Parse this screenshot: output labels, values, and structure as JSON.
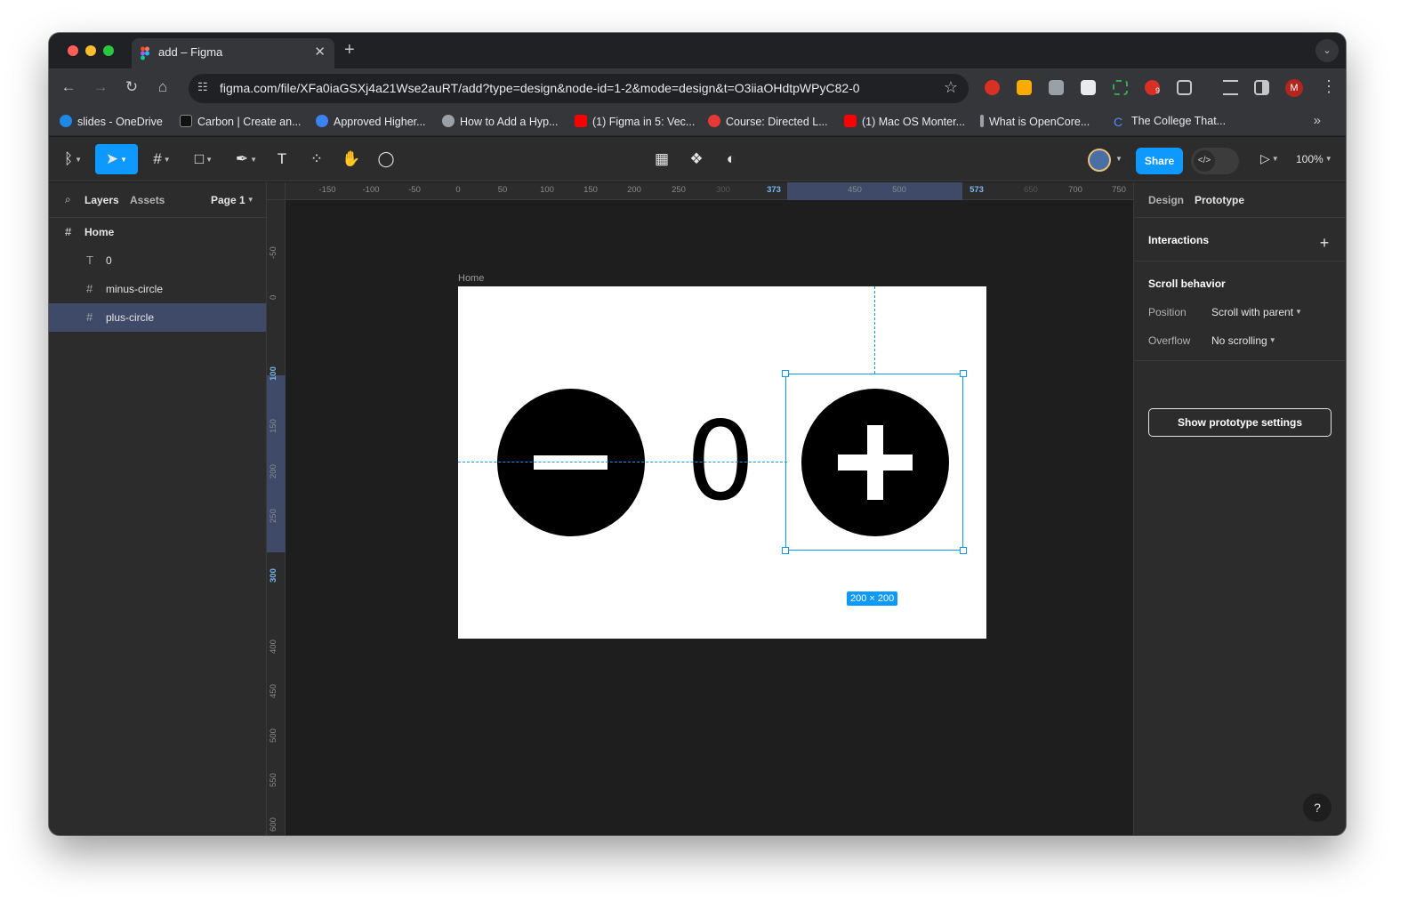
{
  "browser": {
    "tab_title": "add – Figma",
    "url": "figma.com/file/XFa0iaGSXj4a21Wse2auRT/add?type=design&node-id=1-2&mode=design&t=O3iiaOHdtpWPyC82-0",
    "profile_initial": "M",
    "extension_badge": "9",
    "bookmarks": [
      {
        "label": "slides - OneDrive",
        "color": "#1e88e5"
      },
      {
        "label": "Carbon | Create an...",
        "color": "#222222"
      },
      {
        "label": "Approved Higher...",
        "color": "#3b82f6"
      },
      {
        "label": "How to Add a Hyp...",
        "color": "#9aa0a6"
      },
      {
        "label": "(1) Figma in 5: Vec...",
        "color": "#ff0000"
      },
      {
        "label": "Course: Directed L...",
        "color": "#e53935"
      },
      {
        "label": "(1) Mac OS Monter...",
        "color": "#ff0000"
      },
      {
        "label": "What is OpenCore...",
        "color": "#9aa0a6"
      },
      {
        "label": "The College That...",
        "color": "#4f8cff"
      }
    ]
  },
  "figma": {
    "share_label": "Share",
    "zoom": "100%",
    "left_panel": {
      "tab_layers": "Layers",
      "tab_assets": "Assets",
      "page": "Page 1",
      "layers": [
        {
          "name": "Home",
          "icon": "frame-icon",
          "selected": false
        },
        {
          "name": "0",
          "icon": "text-icon",
          "selected": false
        },
        {
          "name": "minus-circle",
          "icon": "frame-icon",
          "selected": false
        },
        {
          "name": "plus-circle",
          "icon": "frame-icon",
          "selected": true
        }
      ]
    },
    "rulers": {
      "top": [
        "-150",
        "-100",
        "-50",
        "0",
        "50",
        "100",
        "150",
        "200",
        "250",
        "300",
        "373",
        "450",
        "500",
        "573",
        "650",
        "700",
        "750"
      ],
      "left": [
        "-50",
        "0",
        "100",
        "150",
        "200",
        "250",
        "300",
        "400",
        "450",
        "500",
        "550",
        "600"
      ]
    },
    "canvas": {
      "frame_name": "Home",
      "counter_text": "0",
      "selection_size": "200 × 200"
    },
    "right_panel": {
      "tab_design": "Design",
      "tab_prototype": "Prototype",
      "interactions": "Interactions",
      "scroll_behavior": "Scroll behavior",
      "position_label": "Position",
      "position_value": "Scroll with parent",
      "overflow_label": "Overflow",
      "overflow_value": "No scrolling",
      "proto_settings": "Show prototype settings",
      "help": "?"
    }
  }
}
